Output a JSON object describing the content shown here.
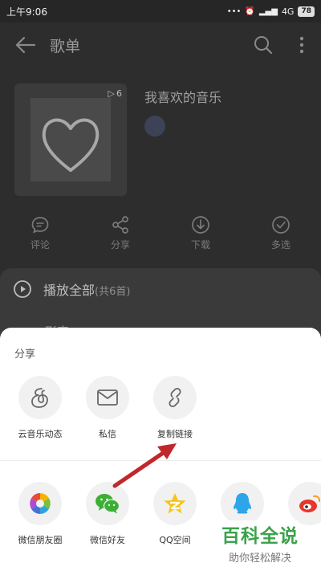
{
  "status_bar": {
    "time": "上午9:06",
    "network": "4G",
    "battery": "78"
  },
  "header": {
    "title": "歌单"
  },
  "playlist": {
    "title": "我喜欢的音乐",
    "play_count": "6",
    "creator": ""
  },
  "actions": [
    {
      "label": "评论",
      "icon": "comment-icon"
    },
    {
      "label": "分享",
      "icon": "share-icon"
    },
    {
      "label": "下载",
      "icon": "download-icon"
    },
    {
      "label": "多选",
      "icon": "multiselect-icon"
    }
  ],
  "list": {
    "play_all": "播放全部",
    "count": "(共6首)",
    "peek": "形容"
  },
  "share_sheet": {
    "title": "分享",
    "row1": [
      {
        "label": "云音乐动态",
        "icon": "cloud-music-feed-icon"
      },
      {
        "label": "私信",
        "icon": "mail-icon"
      },
      {
        "label": "复制链接",
        "icon": "link-icon"
      }
    ],
    "row2": [
      {
        "label": "微信朋友圈",
        "icon": "wechat-moments-icon"
      },
      {
        "label": "微信好友",
        "icon": "wechat-icon"
      },
      {
        "label": "QQ空间",
        "icon": "qzone-icon"
      },
      {
        "label": "",
        "icon": "qq-icon"
      },
      {
        "label": "",
        "icon": "weibo-icon"
      }
    ]
  },
  "watermark": {
    "main": "百科全说",
    "sub": "助你轻松解决"
  },
  "colors": {
    "accent_green": "#3aa24a",
    "arrow_red": "#c0282b"
  }
}
